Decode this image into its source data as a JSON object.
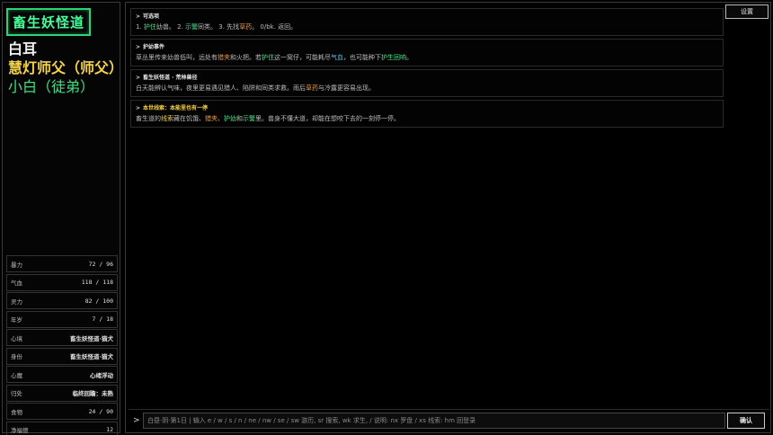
{
  "sidebar": {
    "title": "畜生妖怪道",
    "characters": [
      "白耳",
      "慧灯师父（师父）",
      "小白（徒弟）"
    ],
    "stats": [
      {
        "label": "暴力",
        "value": "72 / 96"
      },
      {
        "label": "气血",
        "value": "118 / 118"
      },
      {
        "label": "灵力",
        "value": "82 / 100"
      },
      {
        "label": "年岁",
        "value": "7 / 18"
      },
      {
        "label": "心境",
        "value": "畜生妖怪道·猫犬"
      },
      {
        "label": "身份",
        "value": "畜生妖怪道·猫犬"
      },
      {
        "label": "心魔",
        "value": "心绪浮动"
      },
      {
        "label": "归处",
        "value": "临终回瞻：未熟"
      },
      {
        "label": "食物",
        "value": "24 / 90"
      },
      {
        "label": "净福德",
        "value": "12"
      }
    ]
  },
  "toolbar": {
    "settings_label": "设置"
  },
  "log": [
    {
      "heading": "可选项",
      "parts": [
        {
          "t": "1. "
        },
        {
          "t": "护住",
          "c": "g"
        },
        {
          "t": "幼兽。 2. "
        },
        {
          "t": "示警",
          "c": "g"
        },
        {
          "t": "同类。 3. 先找"
        },
        {
          "t": "草药",
          "c": "o"
        },
        {
          "t": "。 0/bk. 返回。"
        }
      ]
    },
    {
      "heading": "护幼事件",
      "parts": [
        {
          "t": "草丛里传来幼兽低叫，远处有"
        },
        {
          "t": "猎夹",
          "c": "o"
        },
        {
          "t": "和火把。若"
        },
        {
          "t": "护住",
          "c": "g"
        },
        {
          "t": "这一窝仔，可能耗尽"
        },
        {
          "t": "气血",
          "c": "c"
        },
        {
          "t": "，也可能种下"
        },
        {
          "t": "护生回响",
          "c": "g"
        },
        {
          "t": "。"
        }
      ]
    },
    {
      "heading": "畜生妖怪道 · 荒林兽径",
      "parts": [
        {
          "t": "白天能辨认气味，夜里更易遇见猎人、陷阱和同类求救。雨后"
        },
        {
          "t": "草药",
          "c": "o"
        },
        {
          "t": "与冷露更容易出现。"
        }
      ]
    },
    {
      "heading": "本世线索：本能里也有一停",
      "heading_color": "y",
      "parts": [
        {
          "t": "畜生道的"
        },
        {
          "t": "线索",
          "c": "y"
        },
        {
          "t": "藏在饥饿、"
        },
        {
          "t": "猎夹",
          "c": "o"
        },
        {
          "t": "、"
        },
        {
          "t": "护幼",
          "c": "g"
        },
        {
          "t": "和"
        },
        {
          "t": "示警",
          "c": "g"
        },
        {
          "t": "里。兽身不懂大道，却能在想咬下去的一刻停一停。"
        }
      ]
    }
  ],
  "input": {
    "prompt": ">",
    "placeholder": "白昼·阴·第1日 | 输入 e / w / s / n / ne / nw / se / sw 游历, sr 搜索, wk 求生, / 说明: nx 罗盘 / xs 线索: hm 回登录",
    "confirm_label": "确认"
  }
}
